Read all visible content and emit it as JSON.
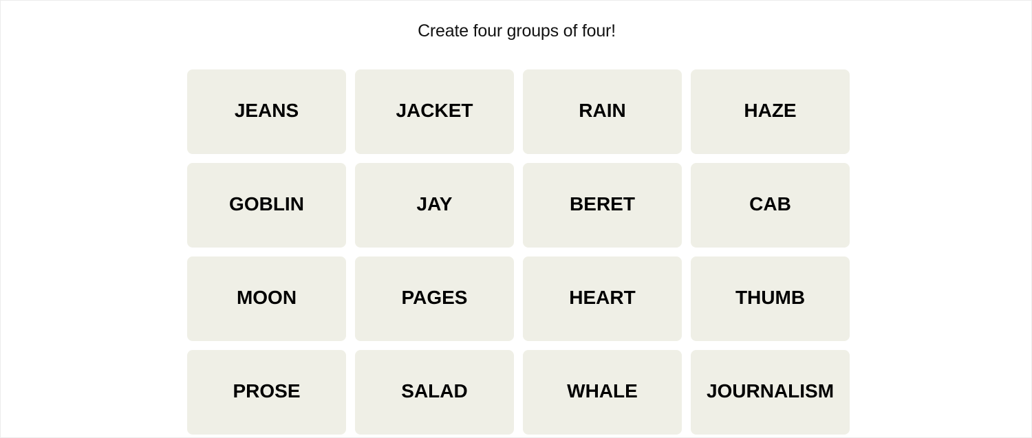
{
  "game": {
    "prompt": "Create four groups of four!",
    "tile_color": "#efefe6",
    "tiles": [
      "JEANS",
      "JACKET",
      "RAIN",
      "HAZE",
      "GOBLIN",
      "JAY",
      "BERET",
      "CAB",
      "MOON",
      "PAGES",
      "HEART",
      "THUMB",
      "PROSE",
      "SALAD",
      "WHALE",
      "JOURNALISM"
    ]
  }
}
